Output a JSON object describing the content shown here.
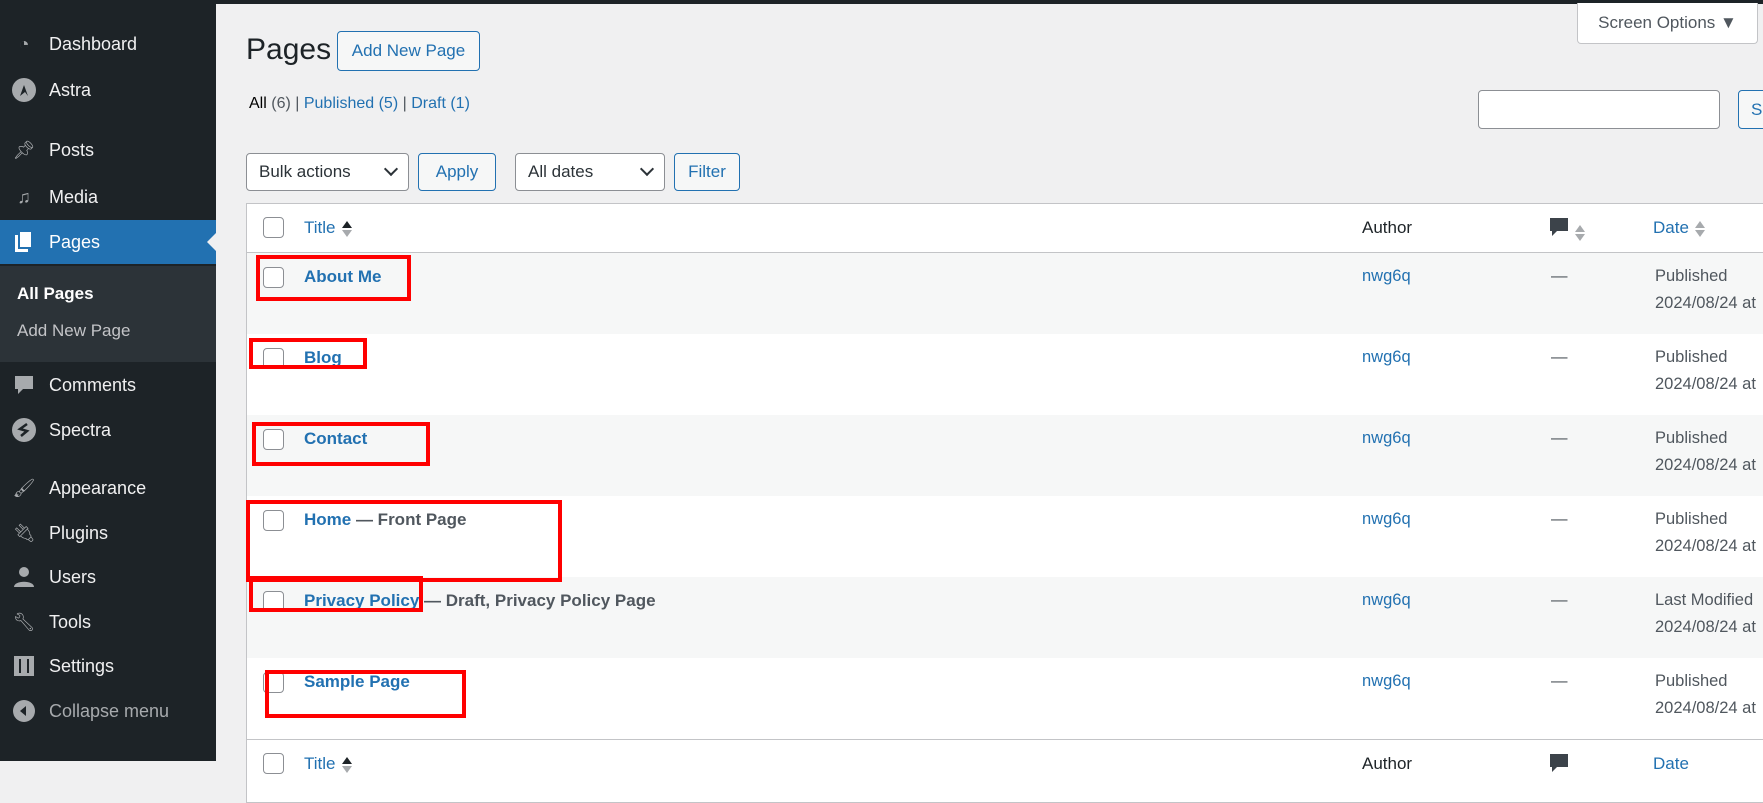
{
  "sidebar": {
    "items": [
      {
        "label": "Dashboard",
        "icon": "dashboard-icon"
      },
      {
        "label": "Astra",
        "icon": "astra-icon"
      },
      {
        "label": "Posts",
        "icon": "pin-icon"
      },
      {
        "label": "Media",
        "icon": "media-icon"
      },
      {
        "label": "Pages",
        "icon": "pages-icon",
        "active": true
      },
      {
        "label": "Comments",
        "icon": "comment-icon"
      },
      {
        "label": "Spectra",
        "icon": "spectra-icon"
      },
      {
        "label": "Appearance",
        "icon": "brush-icon"
      },
      {
        "label": "Plugins",
        "icon": "plugin-icon"
      },
      {
        "label": "Users",
        "icon": "user-icon"
      },
      {
        "label": "Tools",
        "icon": "wrench-icon"
      },
      {
        "label": "Settings",
        "icon": "settings-icon"
      }
    ],
    "submenu": [
      "All Pages",
      "Add New Page"
    ],
    "collapse": "Collapse menu"
  },
  "header": {
    "title": "Pages",
    "add_new": "Add New Page",
    "screen_options": "Screen Options ▼"
  },
  "filters": {
    "all": "All",
    "all_count": "(6)",
    "published": "Published",
    "published_count": "(5)",
    "draft": "Draft",
    "draft_count": "(1)",
    "sep": "|"
  },
  "search": {
    "value": "",
    "button": "Se"
  },
  "actions": {
    "bulk": "Bulk actions",
    "apply": "Apply",
    "dates": "All dates",
    "filter": "Filter"
  },
  "table": {
    "columns": {
      "title": "Title",
      "author": "Author",
      "date": "Date"
    },
    "rows": [
      {
        "title": "About Me",
        "state": "",
        "author": "nwg6q",
        "comments": "—",
        "status": "Published",
        "date": "2024/08/24 at"
      },
      {
        "title": "Blog",
        "state": "",
        "author": "nwg6q",
        "comments": "—",
        "status": "Published",
        "date": "2024/08/24 at"
      },
      {
        "title": "Contact",
        "state": "",
        "author": "nwg6q",
        "comments": "—",
        "status": "Published",
        "date": "2024/08/24 at"
      },
      {
        "title": "Home",
        "state": " — Front Page",
        "author": "nwg6q",
        "comments": "—",
        "status": "Published",
        "date": "2024/08/24 at"
      },
      {
        "title": "Privacy Policy",
        "state": " — Draft, Privacy Policy Page",
        "author": "nwg6q",
        "comments": "—",
        "status": "Last Modified",
        "date": "2024/08/24 at"
      },
      {
        "title": "Sample Page",
        "state": "",
        "author": "nwg6q",
        "comments": "—",
        "status": "Published",
        "date": "2024/08/24 at"
      }
    ]
  },
  "colors": {
    "sidebar": "#1d2327",
    "accent": "#2271b1",
    "annotation": "#ff0000"
  }
}
